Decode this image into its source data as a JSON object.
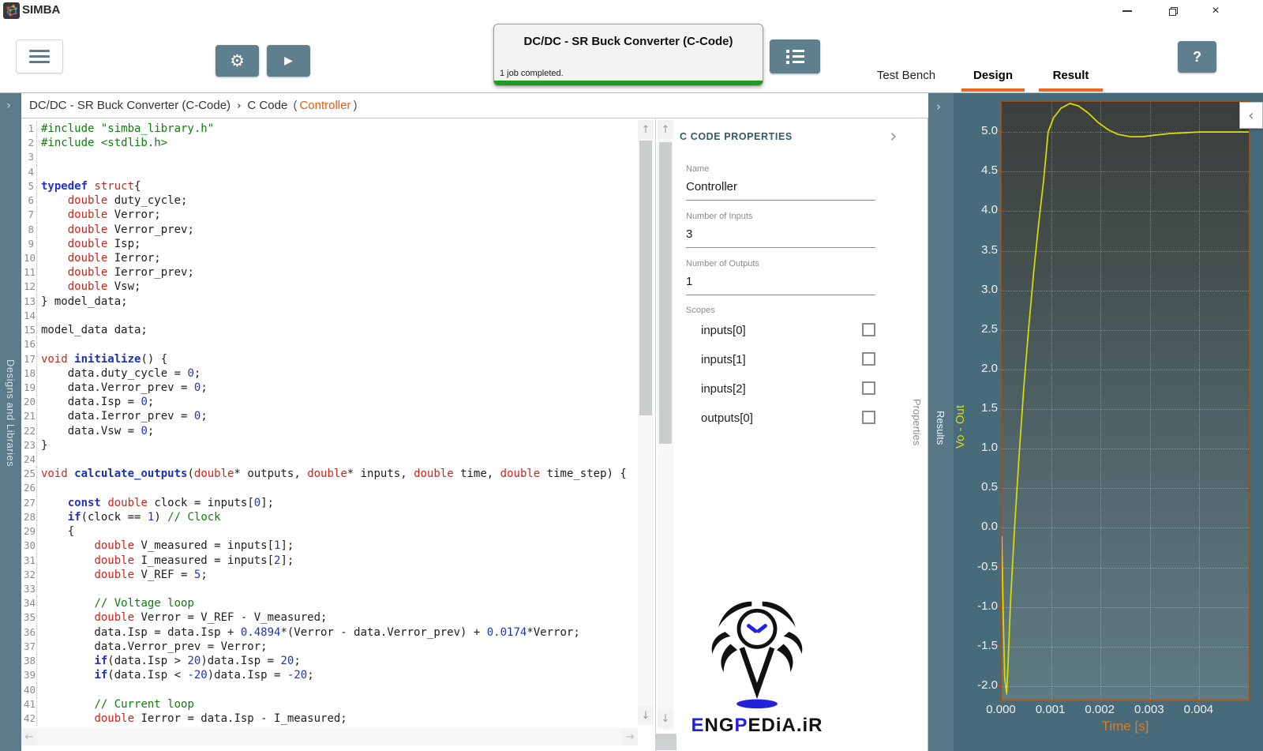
{
  "colors": {
    "accent_orange": "#f0661d",
    "progress_green": "#1f9b1f",
    "slate_button": "#5f7e8e",
    "chart_line": "#d9df00",
    "chart_bg_top": "#3b3e3d",
    "chart_bg_bottom": "#5f7a82"
  },
  "window": {
    "app_name": "SIMBA",
    "close_glyph": "×"
  },
  "toolbar": {
    "job_card": {
      "title": "DC/DC - SR Buck Converter (C-Code)",
      "status": "1 job completed."
    },
    "tabs": [
      {
        "label": "Test Bench",
        "active": false
      },
      {
        "label": "Design",
        "active": true
      },
      {
        "label": "Result",
        "active": true
      }
    ],
    "help_label": "?"
  },
  "sidebar": {
    "label": "Designs and Libraries",
    "chevron": "›"
  },
  "breadcrumb": {
    "design": "DC/DC - SR Buck Converter (C-Code)",
    "separator": "›",
    "page": "C Code",
    "paren_open": "(",
    "name": "Controller",
    "paren_close": ")"
  },
  "code": {
    "lines": [
      [
        [
          "g",
          "#include \"simba_library.h\""
        ]
      ],
      [
        [
          "g",
          "#include <stdlib.h>"
        ]
      ],
      [],
      [],
      [
        [
          "k",
          "typedef "
        ],
        [
          "t",
          "struct"
        ],
        [
          "p",
          "{"
        ]
      ],
      [
        [
          "p",
          "    "
        ],
        [
          "t",
          "double"
        ],
        [
          "p",
          " duty_cycle;"
        ]
      ],
      [
        [
          "p",
          "    "
        ],
        [
          "t",
          "double"
        ],
        [
          "p",
          " Verror;"
        ]
      ],
      [
        [
          "p",
          "    "
        ],
        [
          "t",
          "double"
        ],
        [
          "p",
          " Verror_prev;"
        ]
      ],
      [
        [
          "p",
          "    "
        ],
        [
          "t",
          "double"
        ],
        [
          "p",
          " Isp;"
        ]
      ],
      [
        [
          "p",
          "    "
        ],
        [
          "t",
          "double"
        ],
        [
          "p",
          " Ierror;"
        ]
      ],
      [
        [
          "p",
          "    "
        ],
        [
          "t",
          "double"
        ],
        [
          "p",
          " Ierror_prev;"
        ]
      ],
      [
        [
          "p",
          "    "
        ],
        [
          "t",
          "double"
        ],
        [
          "p",
          " Vsw;"
        ]
      ],
      [
        [
          "p",
          "} model_data;"
        ]
      ],
      [],
      [
        [
          "p",
          "model_data data;"
        ]
      ],
      [],
      [
        [
          "t",
          "void "
        ],
        [
          "f",
          "initialize"
        ],
        [
          "p",
          "() {"
        ]
      ],
      [
        [
          "p",
          "    data.duty_cycle = "
        ],
        [
          "n",
          "0"
        ],
        [
          "p",
          ";"
        ]
      ],
      [
        [
          "p",
          "    data.Verror_prev = "
        ],
        [
          "n",
          "0"
        ],
        [
          "p",
          ";"
        ]
      ],
      [
        [
          "p",
          "    data.Isp = "
        ],
        [
          "n",
          "0"
        ],
        [
          "p",
          ";"
        ]
      ],
      [
        [
          "p",
          "    data.Ierror_prev = "
        ],
        [
          "n",
          "0"
        ],
        [
          "p",
          ";"
        ]
      ],
      [
        [
          "p",
          "    data.Vsw = "
        ],
        [
          "n",
          "0"
        ],
        [
          "p",
          ";"
        ]
      ],
      [
        [
          "p",
          "}"
        ]
      ],
      [],
      [
        [
          "t",
          "void "
        ],
        [
          "f",
          "calculate_outputs"
        ],
        [
          "p",
          "("
        ],
        [
          "t",
          "double"
        ],
        [
          "p",
          "* outputs, "
        ],
        [
          "t",
          "double"
        ],
        [
          "p",
          "* inputs, "
        ],
        [
          "t",
          "double"
        ],
        [
          "p",
          " time, "
        ],
        [
          "t",
          "double"
        ],
        [
          "p",
          " time_step) {"
        ]
      ],
      [],
      [
        [
          "p",
          "    "
        ],
        [
          "k",
          "const"
        ],
        [
          "p",
          " "
        ],
        [
          "t",
          "double"
        ],
        [
          "p",
          " clock = inputs["
        ],
        [
          "n",
          "0"
        ],
        [
          "p",
          "];"
        ]
      ],
      [
        [
          "p",
          "    "
        ],
        [
          "k",
          "if"
        ],
        [
          "p",
          "(clock == "
        ],
        [
          "n",
          "1"
        ],
        [
          "p",
          ") "
        ],
        [
          "g",
          "// Clock"
        ]
      ],
      [
        [
          "p",
          "    {"
        ]
      ],
      [
        [
          "p",
          "        "
        ],
        [
          "t",
          "double"
        ],
        [
          "p",
          " V_measured = inputs["
        ],
        [
          "n",
          "1"
        ],
        [
          "p",
          "];"
        ]
      ],
      [
        [
          "p",
          "        "
        ],
        [
          "t",
          "double"
        ],
        [
          "p",
          " I_measured = inputs["
        ],
        [
          "n",
          "2"
        ],
        [
          "p",
          "];"
        ]
      ],
      [
        [
          "p",
          "        "
        ],
        [
          "t",
          "double"
        ],
        [
          "p",
          " V_REF = "
        ],
        [
          "n",
          "5"
        ],
        [
          "p",
          ";"
        ]
      ],
      [],
      [
        [
          "p",
          "        "
        ],
        [
          "g",
          "// Voltage loop"
        ]
      ],
      [
        [
          "p",
          "        "
        ],
        [
          "t",
          "double"
        ],
        [
          "p",
          " Verror = V_REF - V_measured;"
        ]
      ],
      [
        [
          "p",
          "        data.Isp = data.Isp + "
        ],
        [
          "n",
          "0.4894"
        ],
        [
          "p",
          "*(Verror - data.Verror_prev) + "
        ],
        [
          "n",
          "0.0174"
        ],
        [
          "p",
          "*Verror;"
        ]
      ],
      [
        [
          "p",
          "        data.Verror_prev = Verror;"
        ]
      ],
      [
        [
          "p",
          "        "
        ],
        [
          "k",
          "if"
        ],
        [
          "p",
          "(data.Isp > "
        ],
        [
          "n",
          "20"
        ],
        [
          "p",
          ")data.Isp = "
        ],
        [
          "n",
          "20"
        ],
        [
          "p",
          ";"
        ]
      ],
      [
        [
          "p",
          "        "
        ],
        [
          "k",
          "if"
        ],
        [
          "p",
          "(data.Isp < "
        ],
        [
          "n",
          "-20"
        ],
        [
          "p",
          ")data.Isp = "
        ],
        [
          "n",
          "-20"
        ],
        [
          "p",
          ";"
        ]
      ],
      [],
      [
        [
          "p",
          "        "
        ],
        [
          "g",
          "// Current loop"
        ]
      ],
      [
        [
          "p",
          "        "
        ],
        [
          "t",
          "double"
        ],
        [
          "p",
          " Ierror = data.Isp - I_measured;"
        ]
      ]
    ]
  },
  "properties": {
    "header": "C CODE PROPERTIES",
    "collapse_chevron": "›",
    "fields": [
      {
        "label": "Name",
        "value": "Controller"
      },
      {
        "label": "Number of Inputs",
        "value": "3"
      },
      {
        "label": "Number of Outputs",
        "value": "1"
      }
    ],
    "scopes_label": "Scopes",
    "scopes": [
      {
        "label": "inputs[0]",
        "checked": false
      },
      {
        "label": "inputs[1]",
        "checked": false
      },
      {
        "label": "inputs[2]",
        "checked": false
      },
      {
        "label": "outputs[0]",
        "checked": false
      }
    ],
    "tab_label": "Properties"
  },
  "results": {
    "tab_label": "Results",
    "chevron": "›"
  },
  "watermark": {
    "segments": [
      {
        "text": "E",
        "color": "#2222dd"
      },
      {
        "text": "NG",
        "color": "#111111"
      },
      {
        "text": "P",
        "color": "#2222dd"
      },
      {
        "text": "EDiA.iR",
        "color": "#111111"
      }
    ]
  },
  "chart_data": {
    "type": "line",
    "title": "",
    "xlabel": "Time [s]",
    "ylabel": "Vo - Out",
    "xlim": [
      0,
      0.005
    ],
    "ylim": [
      -2.17,
      5.38
    ],
    "xticks": [
      0,
      0.001,
      0.002,
      0.003,
      0.004
    ],
    "yticks": [
      5.0,
      4.5,
      4.0,
      3.5,
      3.0,
      2.5,
      2.0,
      1.5,
      1.0,
      0.5,
      0.0,
      -0.5,
      -1.0,
      -1.5,
      -2.0
    ],
    "grid": true,
    "legend": null,
    "line_color": "#d9df00",
    "series": [
      {
        "name": "Vo - Out",
        "x": [
          0.0,
          3e-05,
          6e-05,
          0.0001,
          0.00013,
          0.00018,
          0.00026,
          0.00035,
          0.00045,
          0.00055,
          0.00065,
          0.00075,
          0.00085,
          0.00094,
          0.00105,
          0.0012,
          0.00138,
          0.00155,
          0.00175,
          0.00195,
          0.00215,
          0.00235,
          0.0026,
          0.00285,
          0.0031,
          0.0034,
          0.0037,
          0.004,
          0.0045,
          0.005
        ],
        "y": [
          -0.1,
          -1.1,
          -1.9,
          -2.1,
          -1.7,
          -0.9,
          0.0,
          0.9,
          1.8,
          2.55,
          3.25,
          3.85,
          4.4,
          5.0,
          5.18,
          5.3,
          5.36,
          5.33,
          5.24,
          5.12,
          5.03,
          4.97,
          4.94,
          4.94,
          4.96,
          4.98,
          4.99,
          5.0,
          5.0,
          5.0
        ]
      }
    ]
  }
}
